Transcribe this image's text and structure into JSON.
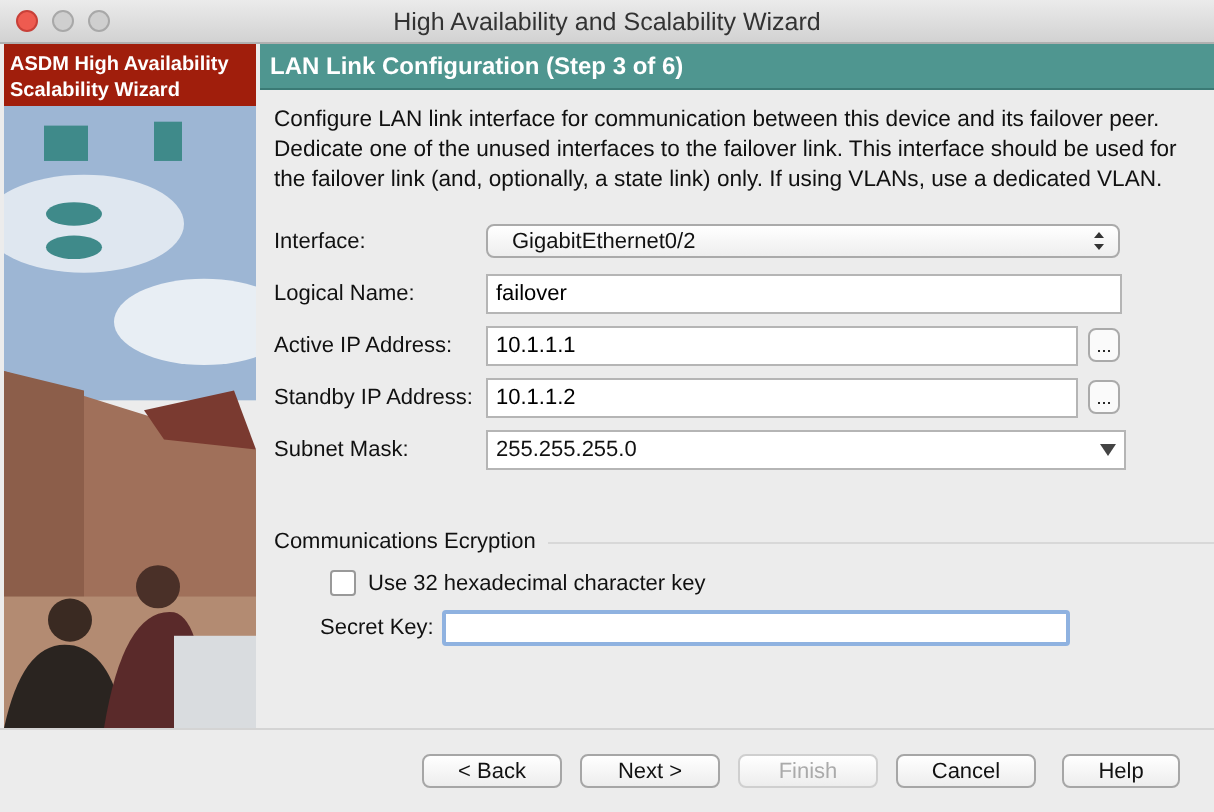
{
  "window": {
    "title": "High Availability and Scalability Wizard"
  },
  "sidebar": {
    "title": "ASDM High Availability Scalability Wizard",
    "kind": "picture"
  },
  "page": {
    "title": "LAN Link Configuration (Step 3 of 6)",
    "description": "Configure LAN link interface for communication between this device and its failover peer. Dedicate one of the unused interfaces to the failover link. This interface should be used for the failover link (and, optionally, a state link) only. If using VLANs, use a dedicated VLAN."
  },
  "fields": [
    {
      "kind": "select",
      "label": "Interface:",
      "value": "GigabitEthernet0/2"
    },
    {
      "kind": "text",
      "label": "Logical Name:",
      "value": "failover"
    },
    {
      "kind": "browse",
      "label": "Active IP Address:",
      "value": "10.1.1.1",
      "button": "..."
    },
    {
      "kind": "browse",
      "label": "Standby IP Address:",
      "value": "10.1.1.2",
      "button": "..."
    },
    {
      "kind": "combo",
      "label": "Subnet Mask:",
      "value": "255.255.255.0"
    }
  ],
  "encryption": {
    "title": "Communications Ecryption",
    "checkbox": {
      "label": "Use 32 hexadecimal character key",
      "checked": false
    },
    "secret_key": {
      "label": "Secret Key:",
      "focused": true
    }
  },
  "buttons": [
    {
      "label": "< Back",
      "disabled": false
    },
    {
      "label": "Next >",
      "disabled": false
    },
    {
      "label": "Finish",
      "disabled": true
    },
    {
      "label": "Cancel",
      "disabled": false
    },
    {
      "label": "Help",
      "disabled": false
    }
  ]
}
